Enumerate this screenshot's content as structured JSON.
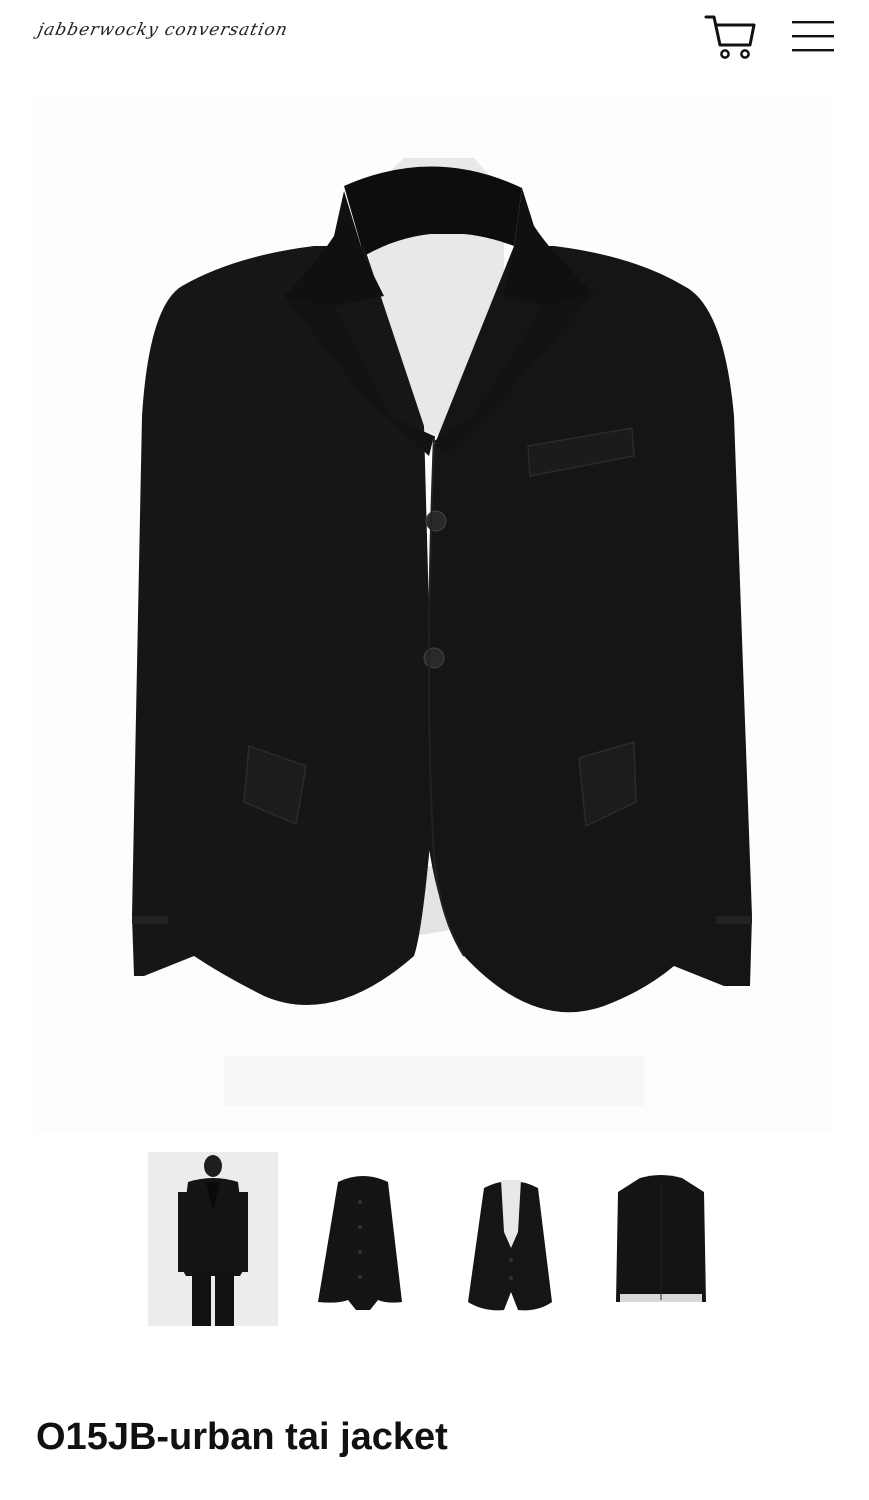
{
  "header": {
    "logo_text": "jabberwocky conversation",
    "cart_icon": "cart-icon",
    "menu_icon": "hamburger-menu-icon"
  },
  "product": {
    "main_image": "black-jacket-front-image",
    "thumbnails": [
      {
        "name": "thumbnail-model-wearing-jacket"
      },
      {
        "name": "thumbnail-jacket-side-buttoned"
      },
      {
        "name": "thumbnail-jacket-front-open"
      },
      {
        "name": "thumbnail-jacket-back"
      }
    ],
    "title": "O15JB-urban tai jacket"
  },
  "colors": {
    "jacket": "#141414",
    "lining": "#e6e6e6",
    "background": "#ffffff",
    "text": "#111111"
  }
}
